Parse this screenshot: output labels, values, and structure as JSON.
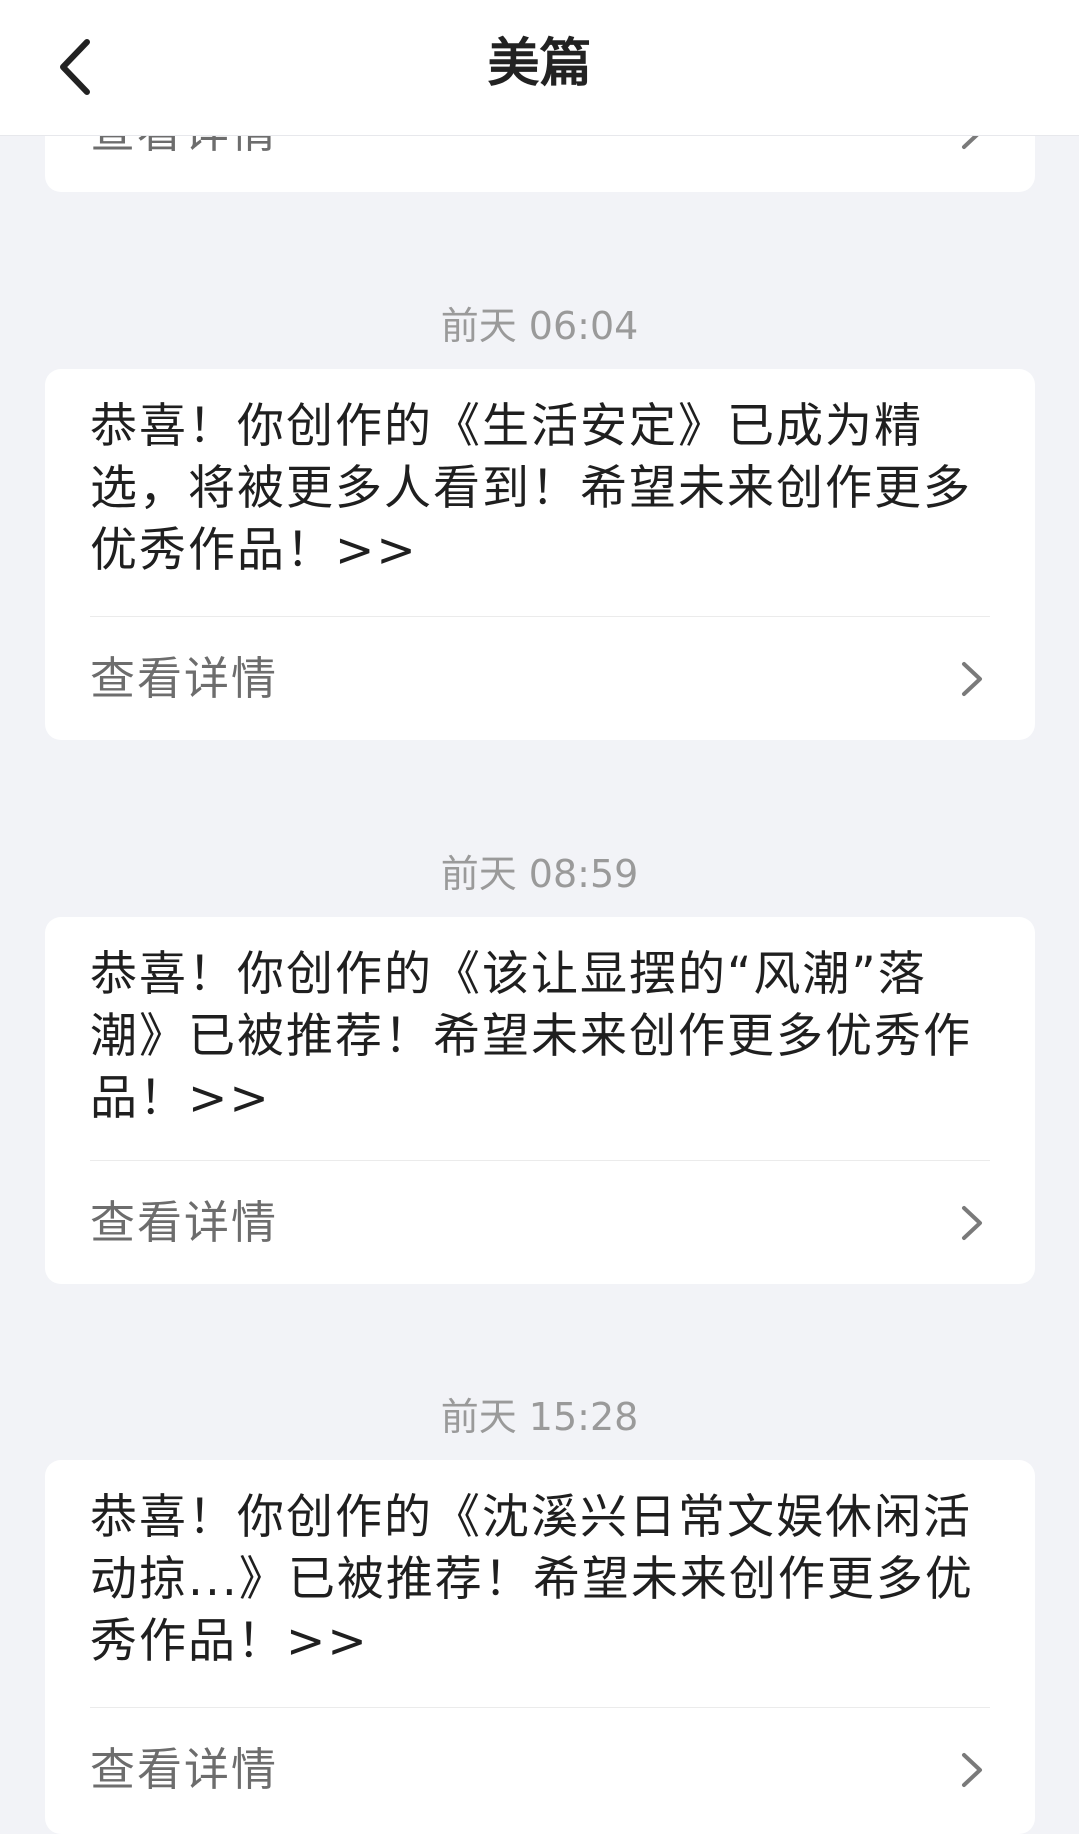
{
  "header": {
    "title": "美篇",
    "back_icon": "chevron-left-icon"
  },
  "partial_card": {
    "detail_label": "查看详情"
  },
  "messages": [
    {
      "timestamp": "前天 06:04",
      "text": "恭喜！你创作的《生活安定》已成为精选，将被更多人看到！希望未来创作更多优秀作品！>>",
      "detail_label": "查看详情"
    },
    {
      "timestamp": "前天 08:59",
      "text": "恭喜！你创作的《该让显摆的“风潮”落潮》已被推荐！希望未来创作更多优秀作品！>>",
      "detail_label": "查看详情"
    },
    {
      "timestamp": "前天 15:28",
      "text": "恭喜！你创作的《沈溪兴日常文娱休闲活动掠...》已被推荐！希望未来创作更多优秀作品！>>",
      "detail_label": "查看详情"
    }
  ],
  "colors": {
    "background": "#f2f3f7",
    "card": "#ffffff",
    "timestamp": "#9a9a9a",
    "text": "#1f1f1f",
    "detail": "#6d6d6d"
  }
}
